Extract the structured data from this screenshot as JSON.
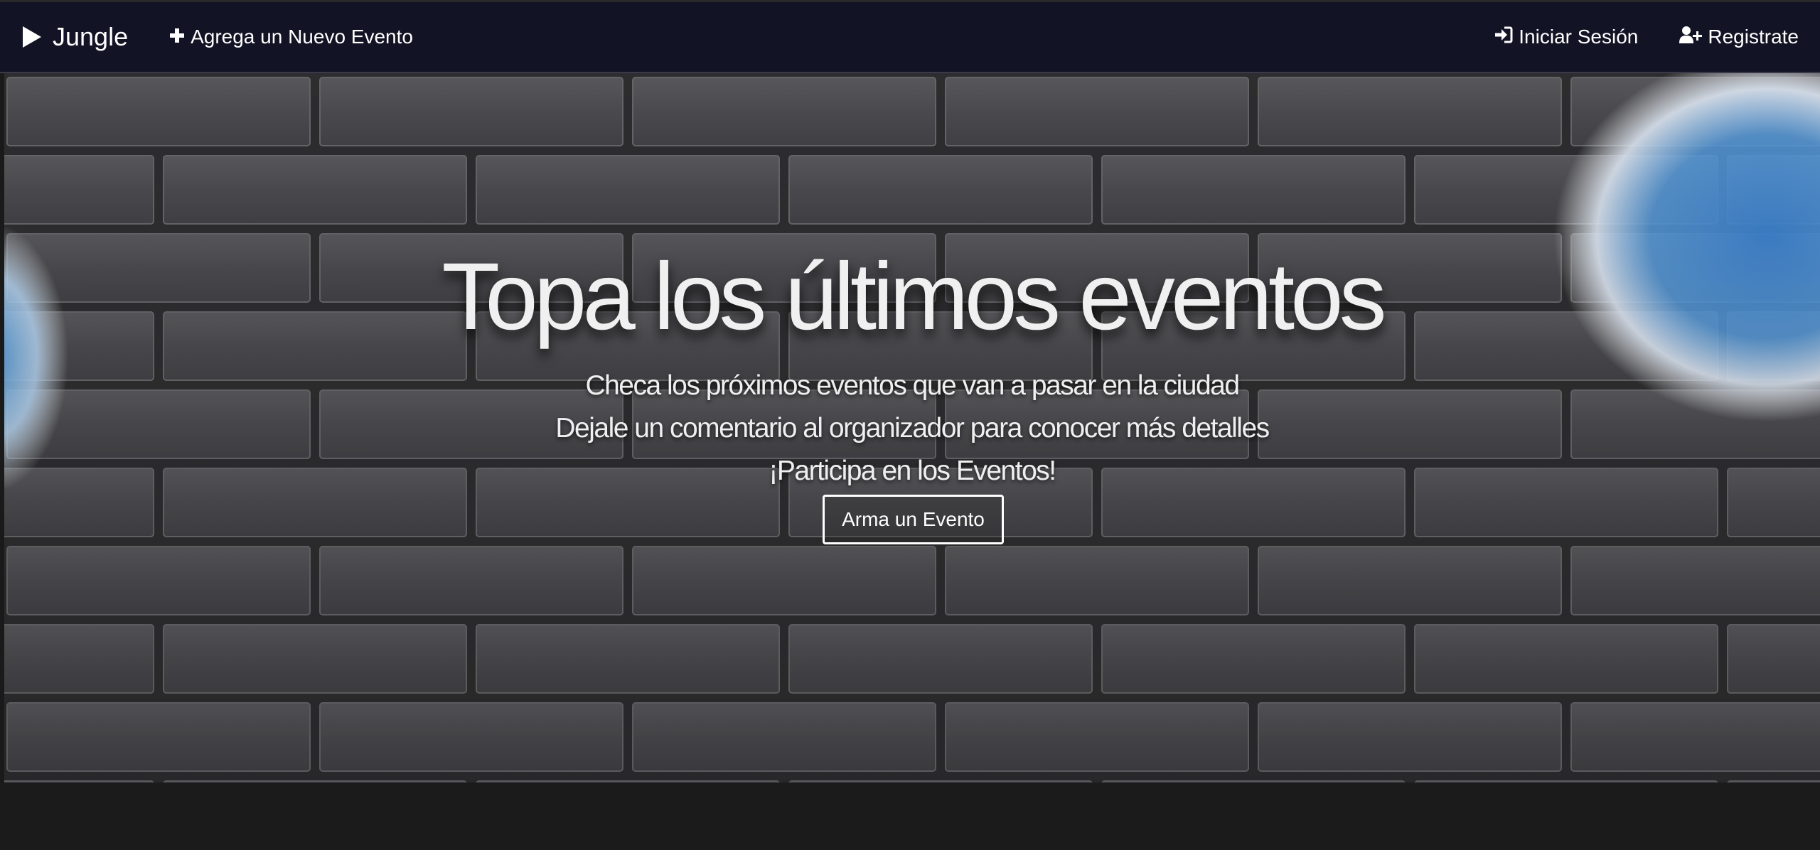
{
  "navbar": {
    "brand_label": "Jungle",
    "add_event_label": "Agrega un Nuevo Evento",
    "login_label": "Iniciar Sesión",
    "register_label": "Registrate",
    "background_color": "#121324"
  },
  "hero": {
    "title": "Topa los últimos eventos",
    "line1": "Checa los próximos eventos que van a pasar en la ciudad",
    "line2": "Dejale un comentario al organizador para conocer más detalles",
    "line3": "¡Participa en los Eventos!",
    "button_label": "Arma un Evento",
    "background": "brick-wall-with-graffiti"
  },
  "icons": {
    "brand": "play-icon",
    "add_event": "plus-icon",
    "login": "sign-in-icon",
    "register": "user-plus-icon"
  }
}
